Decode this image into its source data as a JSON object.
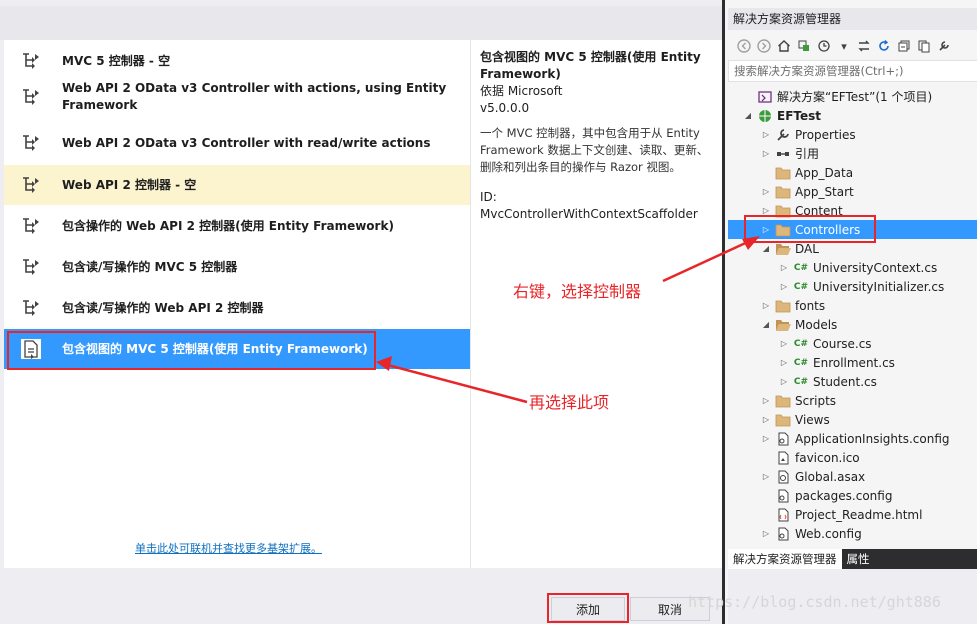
{
  "dialog": {
    "templates": [
      {
        "label": "MVC 5 控制器 - 空",
        "state": "normal"
      },
      {
        "label": "Web API 2 OData v3 Controller with actions, using Entity Framework",
        "state": "normal"
      },
      {
        "label": "Web API 2 OData v3 Controller with read/write actions",
        "state": "normal"
      },
      {
        "label": "Web API 2 控制器 - 空",
        "state": "hover"
      },
      {
        "label": "包含操作的 Web API 2 控制器(使用 Entity Framework)",
        "state": "normal"
      },
      {
        "label": "包含读/写操作的 MVC 5 控制器",
        "state": "normal"
      },
      {
        "label": "包含读/写操作的 Web API 2 控制器",
        "state": "normal"
      },
      {
        "label": "包含视图的 MVC 5 控制器(使用 Entity Framework)",
        "state": "selected"
      }
    ],
    "description": {
      "title": "包含视图的 MVC 5 控制器(使用 Entity Framework)",
      "by": "依据 Microsoft",
      "version": "v5.0.0.0",
      "body": "一个 MVC 控制器，其中包含用于从 Entity Framework 数据上下文创建、读取、更新、删除和列出条目的操作与 Razor 视图。",
      "id": "ID: MvcControllerWithContextScaffolder"
    },
    "online_link": "单击此处可联机并查找更多基架扩展。",
    "add_label": "添加",
    "cancel_label": "取消"
  },
  "explorer": {
    "title": "解决方案资源管理器",
    "search_placeholder": "搜索解决方案资源管理器(Ctrl+;)",
    "tree": [
      {
        "label": "解决方案“EFTest”(1 个项目)",
        "icon": "solution-icon",
        "depth": 0,
        "twisty": "none"
      },
      {
        "label": "EFTest",
        "icon": "web-project-icon",
        "depth": 0,
        "twisty": "expanded",
        "bold": true
      },
      {
        "label": "Properties",
        "icon": "wrench-icon",
        "depth": 1,
        "twisty": "collapsed"
      },
      {
        "label": "引用",
        "icon": "references-icon",
        "depth": 1,
        "twisty": "collapsed"
      },
      {
        "label": "App_Data",
        "icon": "folder-icon",
        "depth": 1,
        "twisty": "none"
      },
      {
        "label": "App_Start",
        "icon": "folder-icon",
        "depth": 1,
        "twisty": "collapsed"
      },
      {
        "label": "Content",
        "icon": "folder-icon",
        "depth": 1,
        "twisty": "collapsed"
      },
      {
        "label": "Controllers",
        "icon": "folder-icon",
        "depth": 1,
        "twisty": "collapsed",
        "selected": true
      },
      {
        "label": "DAL",
        "icon": "folder-open-icon",
        "depth": 1,
        "twisty": "expanded"
      },
      {
        "label": "UniversityContext.cs",
        "icon": "csharp-file-icon",
        "depth": 2,
        "twisty": "collapsed"
      },
      {
        "label": "UniversityInitializer.cs",
        "icon": "csharp-file-icon",
        "depth": 2,
        "twisty": "collapsed"
      },
      {
        "label": "fonts",
        "icon": "folder-icon",
        "depth": 1,
        "twisty": "collapsed"
      },
      {
        "label": "Models",
        "icon": "folder-open-icon",
        "depth": 1,
        "twisty": "expanded"
      },
      {
        "label": "Course.cs",
        "icon": "csharp-file-icon",
        "depth": 2,
        "twisty": "collapsed"
      },
      {
        "label": "Enrollment.cs",
        "icon": "csharp-file-icon",
        "depth": 2,
        "twisty": "collapsed"
      },
      {
        "label": "Student.cs",
        "icon": "csharp-file-icon",
        "depth": 2,
        "twisty": "collapsed"
      },
      {
        "label": "Scripts",
        "icon": "folder-icon",
        "depth": 1,
        "twisty": "collapsed"
      },
      {
        "label": "Views",
        "icon": "folder-icon",
        "depth": 1,
        "twisty": "collapsed"
      },
      {
        "label": "ApplicationInsights.config",
        "icon": "config-file-icon",
        "depth": 1,
        "twisty": "collapsed"
      },
      {
        "label": "favicon.ico",
        "icon": "image-file-icon",
        "depth": 1,
        "twisty": "none"
      },
      {
        "label": "Global.asax",
        "icon": "global-asax-icon",
        "depth": 1,
        "twisty": "collapsed"
      },
      {
        "label": "packages.config",
        "icon": "config-file-icon",
        "depth": 1,
        "twisty": "none"
      },
      {
        "label": "Project_Readme.html",
        "icon": "html-file-icon",
        "depth": 1,
        "twisty": "none"
      },
      {
        "label": "Web.config",
        "icon": "config-file-icon",
        "depth": 1,
        "twisty": "collapsed"
      }
    ],
    "tabs": [
      {
        "label": "解决方案资源管理器",
        "active": true
      },
      {
        "label": "属性",
        "active": false
      }
    ]
  },
  "annotations": {
    "right_click_text": "右键，选择控制器",
    "choose_text": "再选择此项",
    "color": "#e8262a"
  },
  "watermark": "https://blog.csdn.net/ght886"
}
